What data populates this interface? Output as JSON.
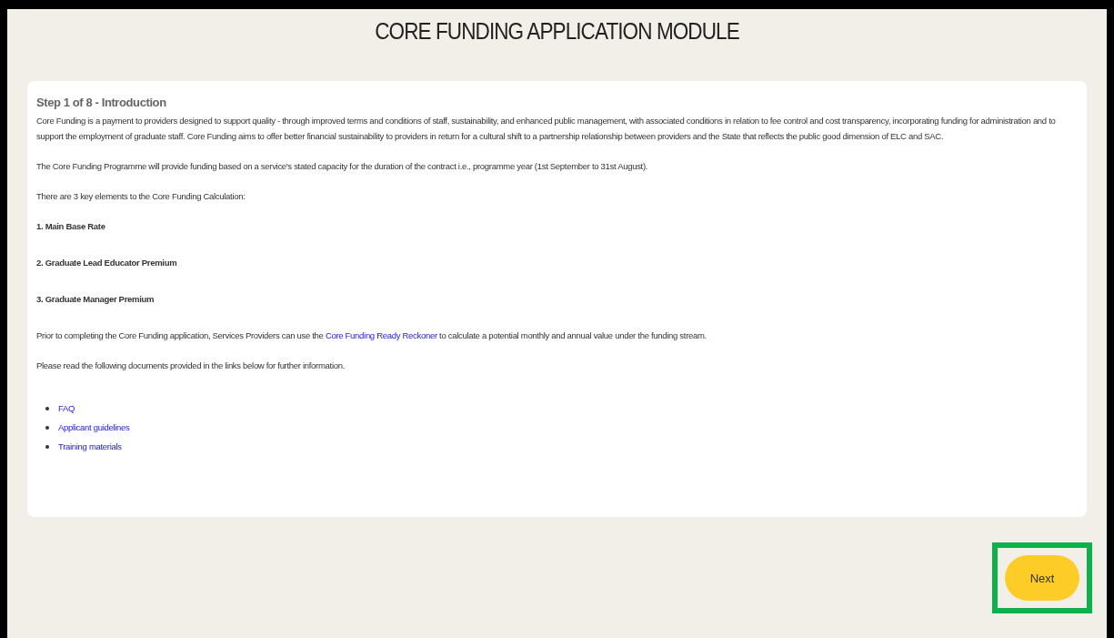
{
  "page": {
    "title": "CORE FUNDING APPLICATION MODULE"
  },
  "step": {
    "heading": "Step 1 of 8 - Introduction",
    "paragraphs": [
      {
        "kind": "text",
        "text": "Core Funding is a payment to providers designed to support quality - through improved terms and conditions of staff, sustainability, and enhanced public management, with associated conditions in relation to fee control and cost transparency, incorporating funding for administration and to support the employment of graduate staff. Core Funding aims to offer better financial sustainability to providers in return for a cultural shift to a partnership relationship between providers and the State that reflects the public good dimension of ELC and SAC."
      },
      {
        "kind": "text",
        "text": "The Core Funding Programme will provide funding based on a service's stated capacity for the duration of the contract i.e., programme year (1st September to 31st August)."
      },
      {
        "kind": "text",
        "text": "There are 3 key elements to the Core Funding Calculation:"
      },
      {
        "kind": "bold",
        "text": "1. Main Base Rate"
      },
      {
        "kind": "bold",
        "text": "2. Graduate Lead Educator Premium"
      },
      {
        "kind": "bold",
        "text": "3. Graduate Manager Premium"
      },
      {
        "kind": "linked",
        "before": "Prior to completing the Core Funding application, Services Providers can use the",
        "link": "Core Funding Ready Reckoner",
        "after": "to calculate a potential monthly and annual value under the funding stream."
      },
      {
        "kind": "text",
        "text": "Please read the following documents provided in the links below for further information."
      }
    ],
    "links": [
      "FAQ",
      "Applicant guidelines",
      "Training materials"
    ]
  },
  "next_button": {
    "label": "Next",
    "highlighted": true
  }
}
